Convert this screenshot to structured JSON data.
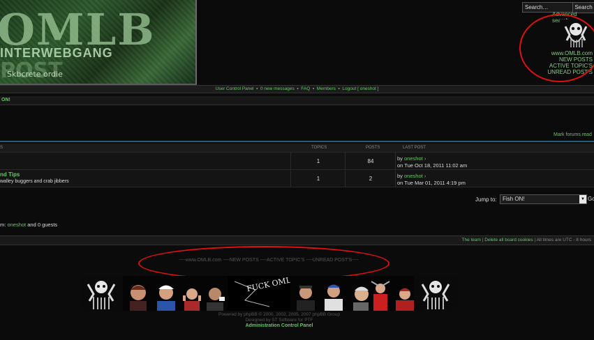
{
  "header": {
    "banner_big": "OMLB",
    "banner_sub": "INTERWEBGANG",
    "banner_post": "POST",
    "banner_tagline": "Skbcrete ordie",
    "search_placeholder": "Search…",
    "search_button": "Search",
    "advanced_search": "Advanced search",
    "right_links": [
      "www.OMLB.com",
      "NEW POSTS",
      "ACTIVE TOPIC'S",
      "UNREAD POST'S"
    ]
  },
  "navbar": {
    "items": [
      "User Control Panel",
      "0 new messages",
      "FAQ",
      "Members",
      "Logout [ oneshot ]"
    ]
  },
  "forum": {
    "title": "ON!",
    "mark_read": "Mark forums read"
  },
  "table": {
    "headers": [
      "TOPICS",
      "POSTS",
      "LAST POST"
    ],
    "first_col_stub": "S",
    "rows": [
      {
        "title": "",
        "desc": "",
        "topics": "1",
        "posts": "84",
        "by": "by",
        "user": "oneshot",
        "date": "on Tue Oct 18, 2011 11:02 am"
      },
      {
        "title": "nd Tips",
        "desc": "walley buggers and crab jibbers",
        "topics": "1",
        "posts": "2",
        "by": "by",
        "user": "oneshot",
        "date": "on Tue Mar 01, 2011 4:19 pm"
      }
    ]
  },
  "jump": {
    "label": "Jump to:",
    "selected": "Fish ON!",
    "go": "Go"
  },
  "online": {
    "prefix": "m:",
    "user": "oneshot",
    "suffix": "and 0 guests"
  },
  "footer_bar": {
    "team": "The team",
    "delete_cookies": "Delete all board cookies",
    "times": "All times are UTC - 8 hours"
  },
  "footer_links": "----www.OMLB.com ----NEW POSTS ----ACTIVE TOPIC'S ----UNREAD POST'S----",
  "strip_text": "FUCK OMLB",
  "powered": [
    "Powered by phpBB © 2000, 2002, 2005, 2007 phpBB Group",
    "Designed by ST Software for PTF"
  ],
  "acp": "Administration Control Panel",
  "colors": {
    "accent_green": "#6ac46a",
    "annotation_red": "#e01010",
    "teal_line": "#1d5e7a"
  }
}
